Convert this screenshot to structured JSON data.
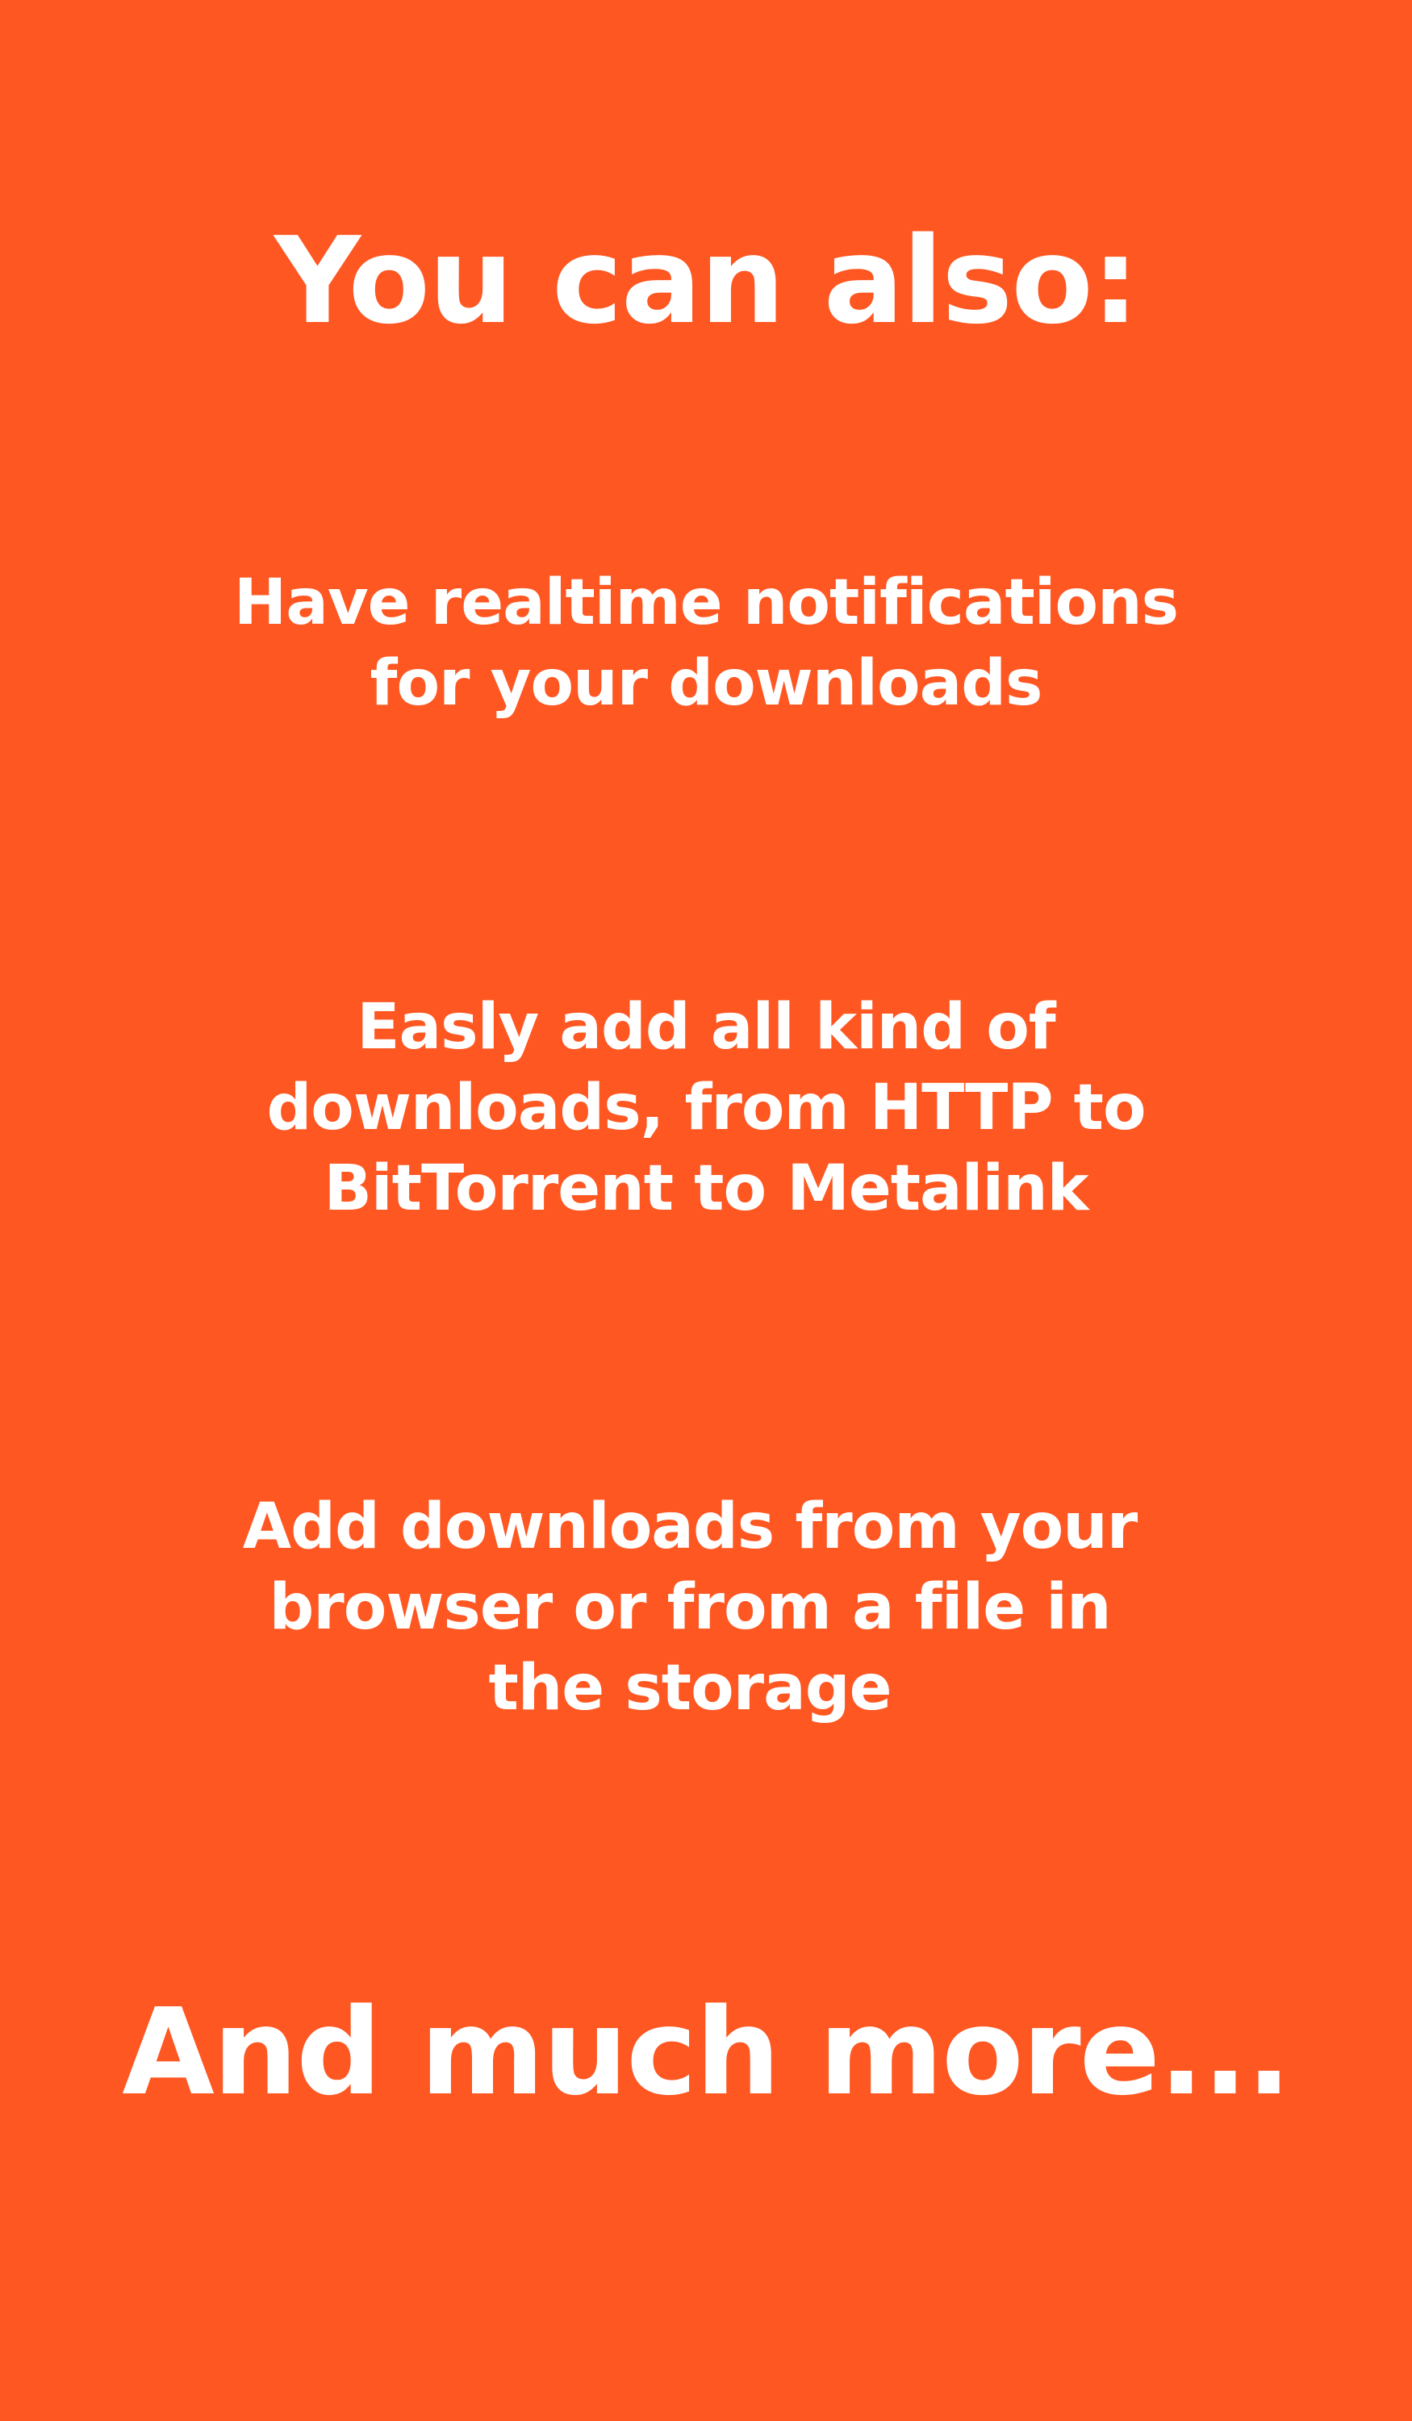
{
  "screen": {
    "background_color": "#FE5722",
    "text_color": "#FFFFFF",
    "heading": "You can also:",
    "features": [
      {
        "lines": [
          "Have realtime notifications",
          "for your downloads"
        ]
      },
      {
        "lines": [
          "Easly add all kind of",
          "downloads, from HTTP to",
          "BitTorrent to Metalink"
        ]
      },
      {
        "lines": [
          "Add downloads from your",
          "browser or from a file in",
          "the storage"
        ]
      }
    ],
    "footer": "And much more..."
  }
}
